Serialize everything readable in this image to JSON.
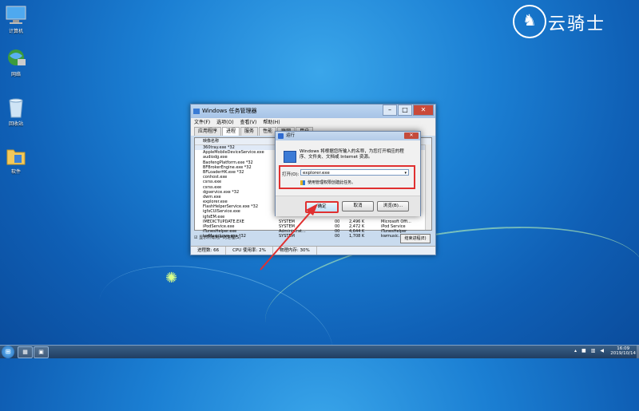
{
  "desktop": {
    "icons": [
      {
        "label": "计算机",
        "icon": "computer-icon"
      },
      {
        "label": "网络",
        "icon": "network-icon"
      },
      {
        "label": "回收站",
        "icon": "recycle-bin-icon"
      },
      {
        "label": "软件",
        "icon": "folder-icon"
      }
    ],
    "logo_text": "云骑士"
  },
  "task_manager": {
    "title": "Windows 任务管理器",
    "menu": [
      "文件(F)",
      "选项(O)",
      "查看(V)",
      "帮助(H)"
    ],
    "tabs": [
      "应用程序",
      "进程",
      "服务",
      "性能",
      "联网",
      "用户"
    ],
    "column_header": "映像名称",
    "processes": [
      [
        "360tray.exe *32",
        "",
        "",
        "",
        ""
      ],
      [
        "AppleMobileDeviceService.exe",
        "",
        "",
        "",
        ""
      ],
      [
        "audiodg.exe",
        "",
        "",
        "",
        ""
      ],
      [
        "BaofengPlatform.exe *32",
        "",
        "",
        "",
        ""
      ],
      [
        "BFBrokerEngine.exe *32",
        "",
        "",
        "",
        ""
      ],
      [
        "BFLoaderHK.exe *32",
        "",
        "",
        "",
        ""
      ],
      [
        "conhost.exe",
        "",
        "",
        "",
        ""
      ],
      [
        "csrss.exe",
        "",
        "",
        "",
        ""
      ],
      [
        "csrss.exe",
        "",
        "",
        "",
        ""
      ],
      [
        "dgservice.exe *32",
        "",
        "",
        "",
        ""
      ],
      [
        "dwm.exe",
        "",
        "",
        "",
        ""
      ],
      [
        "explorer.exe",
        "",
        "",
        "",
        ""
      ],
      [
        "FlashHelperService.exe *32",
        "",
        "",
        "",
        ""
      ],
      [
        "igfxCUIService.exe",
        "",
        "",
        "",
        ""
      ],
      [
        "igfxEM.exe",
        "",
        "",
        "",
        ""
      ],
      [
        "IMEDICTUPDATE.EXE",
        "SYSTEM",
        "00",
        "2,496 K",
        "Microsoft Offi..."
      ],
      [
        "iPodService.exe",
        "SYSTEM",
        "00",
        "2,472 K",
        "iPod Service"
      ],
      [
        "iTunesHelper.exe",
        "Administrat...",
        "00",
        "4,644 K",
        "iTunesHelper"
      ],
      [
        "kwMusicLove.exe *32",
        "SYSTEM",
        "00",
        "1,708 K",
        "kwmusic...d"
      ]
    ],
    "show_all_users": "显示所有用户的进程(S)",
    "end_process": "结束进程(E)",
    "status": [
      "进程数: 66",
      "CPU 使用率: 2%",
      "物理内存: 30%"
    ]
  },
  "run_dialog": {
    "title": "运行",
    "prompt": "Windows 将根据您所输入的名称，为您打开相应的程序、文件夹、文档或 Internet 资源。",
    "open_label": "打开(O):",
    "input_value": "explorer.exe",
    "admin_note": "使用管理权限创建此任务。",
    "ok": "确定",
    "cancel": "取消",
    "browse": "浏览(B)..."
  },
  "taskbar": {
    "time": "16:09",
    "date": "2019/10/14"
  }
}
